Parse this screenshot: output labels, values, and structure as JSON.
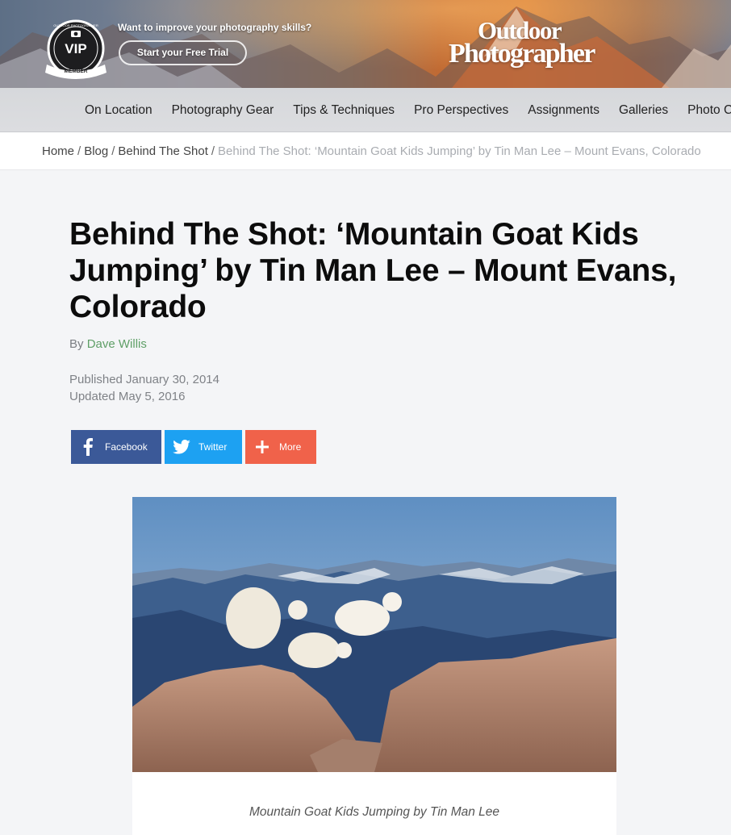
{
  "header": {
    "badge": {
      "ring_text": "OUTDOOR PHOTOGRAPHER",
      "title": "VIP",
      "ribbon": "MEMBER"
    },
    "promo_text": "Want to improve your photography skills?",
    "trial_button": "Start your Free Trial",
    "logo": {
      "line1": "Outdoor",
      "line2": "Photographer"
    }
  },
  "nav": {
    "items": [
      {
        "label": "On Location"
      },
      {
        "label": "Photography Gear"
      },
      {
        "label": "Tips & Techniques"
      },
      {
        "label": "Pro Perspectives"
      },
      {
        "label": "Assignments"
      },
      {
        "label": "Galleries"
      },
      {
        "label": "Photo Contests"
      }
    ]
  },
  "breadcrumb": {
    "home": "Home",
    "blog": "Blog",
    "section": "Behind The Shot",
    "separator": "/",
    "current": "Behind The Shot: ‘Mountain Goat Kids Jumping’ by Tin Man Lee – Mount Evans, Colorado"
  },
  "article": {
    "title": "Behind The Shot: ‘Mountain Goat Kids Jumping’ by Tin Man Lee – Mount Evans, Colorado",
    "by_prefix": "By",
    "author": "Dave Willis",
    "published": "Published January 30, 2014",
    "updated": "Updated May 5, 2016"
  },
  "share": {
    "facebook": "Facebook",
    "twitter": "Twitter",
    "more": "More",
    "colors": {
      "facebook": "#3b5998",
      "twitter": "#1da1f2",
      "more": "#f0624a"
    }
  },
  "figure": {
    "caption": "Mountain Goat Kids Jumping by Tin Man Lee"
  }
}
